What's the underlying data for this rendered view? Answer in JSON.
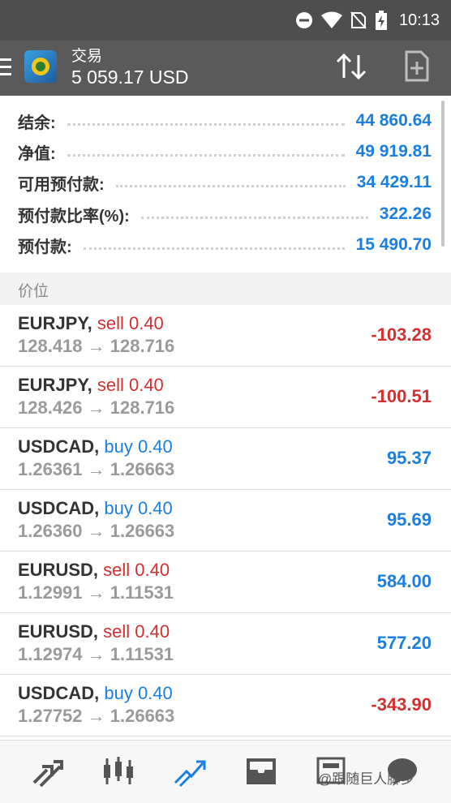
{
  "status_bar": {
    "time": "10:13",
    "icons": [
      "do-not-disturb-icon",
      "wifi-icon",
      "no-sim-icon",
      "battery-charging-icon"
    ]
  },
  "app_bar": {
    "title": "交易",
    "subtitle": "5 059.17 USD",
    "actions": [
      "sort-icon",
      "new-order-icon"
    ]
  },
  "account": {
    "rows": [
      {
        "label": "结余:",
        "value": "44 860.64"
      },
      {
        "label": "净值:",
        "value": "49 919.81"
      },
      {
        "label": "可用预付款:",
        "value": "34 429.11"
      },
      {
        "label": "预付款比率(%):",
        "value": "322.26"
      },
      {
        "label": "预付款:",
        "value": "15 490.70"
      }
    ]
  },
  "section_title": "价位",
  "positions": [
    {
      "symbol": "EURJPY,",
      "side": "sell 0.40",
      "prices": "128.418 → 128.716",
      "profit": "-103.28"
    },
    {
      "symbol": "EURJPY,",
      "side": "sell 0.40",
      "prices": "128.426 → 128.716",
      "profit": "-100.51"
    },
    {
      "symbol": "USDCAD,",
      "side": "buy 0.40",
      "prices": "1.26361 → 1.26663",
      "profit": "95.37"
    },
    {
      "symbol": "USDCAD,",
      "side": "buy 0.40",
      "prices": "1.26360 → 1.26663",
      "profit": "95.69"
    },
    {
      "symbol": "EURUSD,",
      "side": "sell 0.40",
      "prices": "1.12991 → 1.11531",
      "profit": "584.00"
    },
    {
      "symbol": "EURUSD,",
      "side": "sell 0.40",
      "prices": "1.12974 → 1.11531",
      "profit": "577.20"
    },
    {
      "symbol": "USDCAD,",
      "side": "buy 0.40",
      "prices": "1.27752 → 1.26663",
      "profit": "-343.90"
    }
  ],
  "colors": {
    "sell": "#d32f2f",
    "buy": "#1a7fe0",
    "loss": "#d32f2f",
    "gain": "#1a7fe0",
    "accent": "#1a7fe0"
  },
  "bottom_nav": [
    "quotes-icon",
    "chart-icon",
    "trade-icon",
    "history-icon",
    "news-icon",
    "chat-icon"
  ],
  "watermark": "@跟随巨人脚步"
}
